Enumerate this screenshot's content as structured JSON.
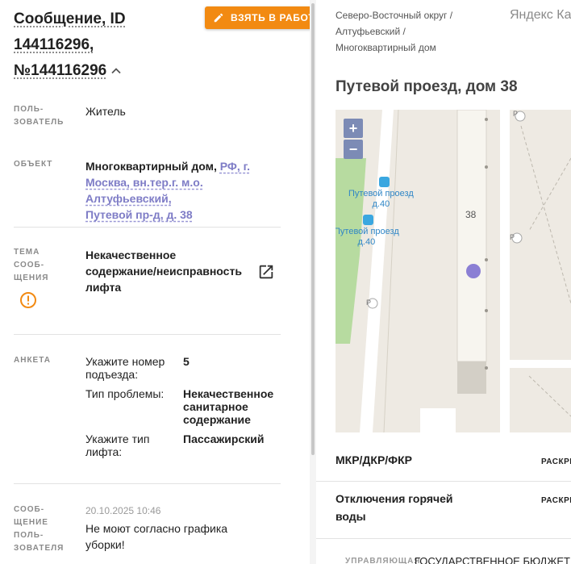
{
  "header": {
    "title_lines": [
      "Сообщение, ID",
      "144116296,",
      "№144116296"
    ],
    "take_button": "ВЗЯТЬ В РАБОТУ"
  },
  "fields": {
    "user": {
      "label_lines": [
        "ПОЛЬ-",
        "ЗОВАТЕЛЬ"
      ],
      "value": "Житель"
    },
    "object": {
      "label": "ОБЪЕКТ",
      "value_prefix": "Многоквартирный дом, ",
      "address_lines": [
        "РФ, г.",
        "Москва, вн.тер.г. м.о. Алтуфьевский,",
        "Путевой пр-д, д. 38"
      ]
    },
    "topic": {
      "label_lines": [
        "ТЕМА",
        "СООБ-",
        "ЩЕНИЯ"
      ],
      "value_lines": [
        "Некачественное",
        "содержание/неисправность",
        "лифта"
      ]
    },
    "survey": {
      "label": "АНКЕТА",
      "rows": [
        {
          "key_lines": [
            "Укажите номер",
            "подъезда:"
          ],
          "value_lines": [
            "5"
          ]
        },
        {
          "key_lines": [
            "Тип проблемы:"
          ],
          "value_lines": [
            "Некачественное",
            "санитарное",
            "содержание"
          ]
        },
        {
          "key_lines": [
            "Укажите тип",
            "лифта:"
          ],
          "value_lines": [
            "Пассажирский"
          ]
        }
      ]
    },
    "user_message": {
      "label_lines": [
        "СООБ-",
        "ЩЕНИЕ",
        "ПОЛЬ-",
        "ЗОВАТЕЛЯ"
      ],
      "date": "20.10.2025 10:46",
      "text_lines": [
        "Не моют согласно графика",
        "уборки!"
      ]
    }
  },
  "right": {
    "breadcrumb_lines": [
      "Северо-Восточный округ /",
      "Алтуфьевский /",
      "Многоквартирный дом"
    ],
    "map_provider": "Яндекс Ка",
    "address_title": "Путевой проезд, дом 38",
    "map": {
      "zoom_in": "+",
      "zoom_out": "−",
      "house_number": "38",
      "bus_stop_1_lines": [
        "Путевой проезд",
        "д.40"
      ],
      "bus_stop_2_lines": [
        "Путевой проезд",
        "д.40"
      ],
      "parking": "P"
    },
    "sections": [
      {
        "title_lines": [
          "МКР/ДКР/ФКР"
        ],
        "action": "РАСКРЫТЬ"
      },
      {
        "title_lines": [
          "Отключения горячей",
          "воды"
        ],
        "action": "РАСКРЫТЬ"
      }
    ],
    "management": {
      "label": "УПРАВЛЯЮЩАЯ",
      "value": "ГОСУДАРСТВЕННОЕ БЮДЖЕТ"
    }
  },
  "colors": {
    "accent_orange": "#f28a12",
    "link_purple": "#7e7cc6",
    "marker": "#8b7fd4",
    "map_park": "#b7dba0"
  }
}
